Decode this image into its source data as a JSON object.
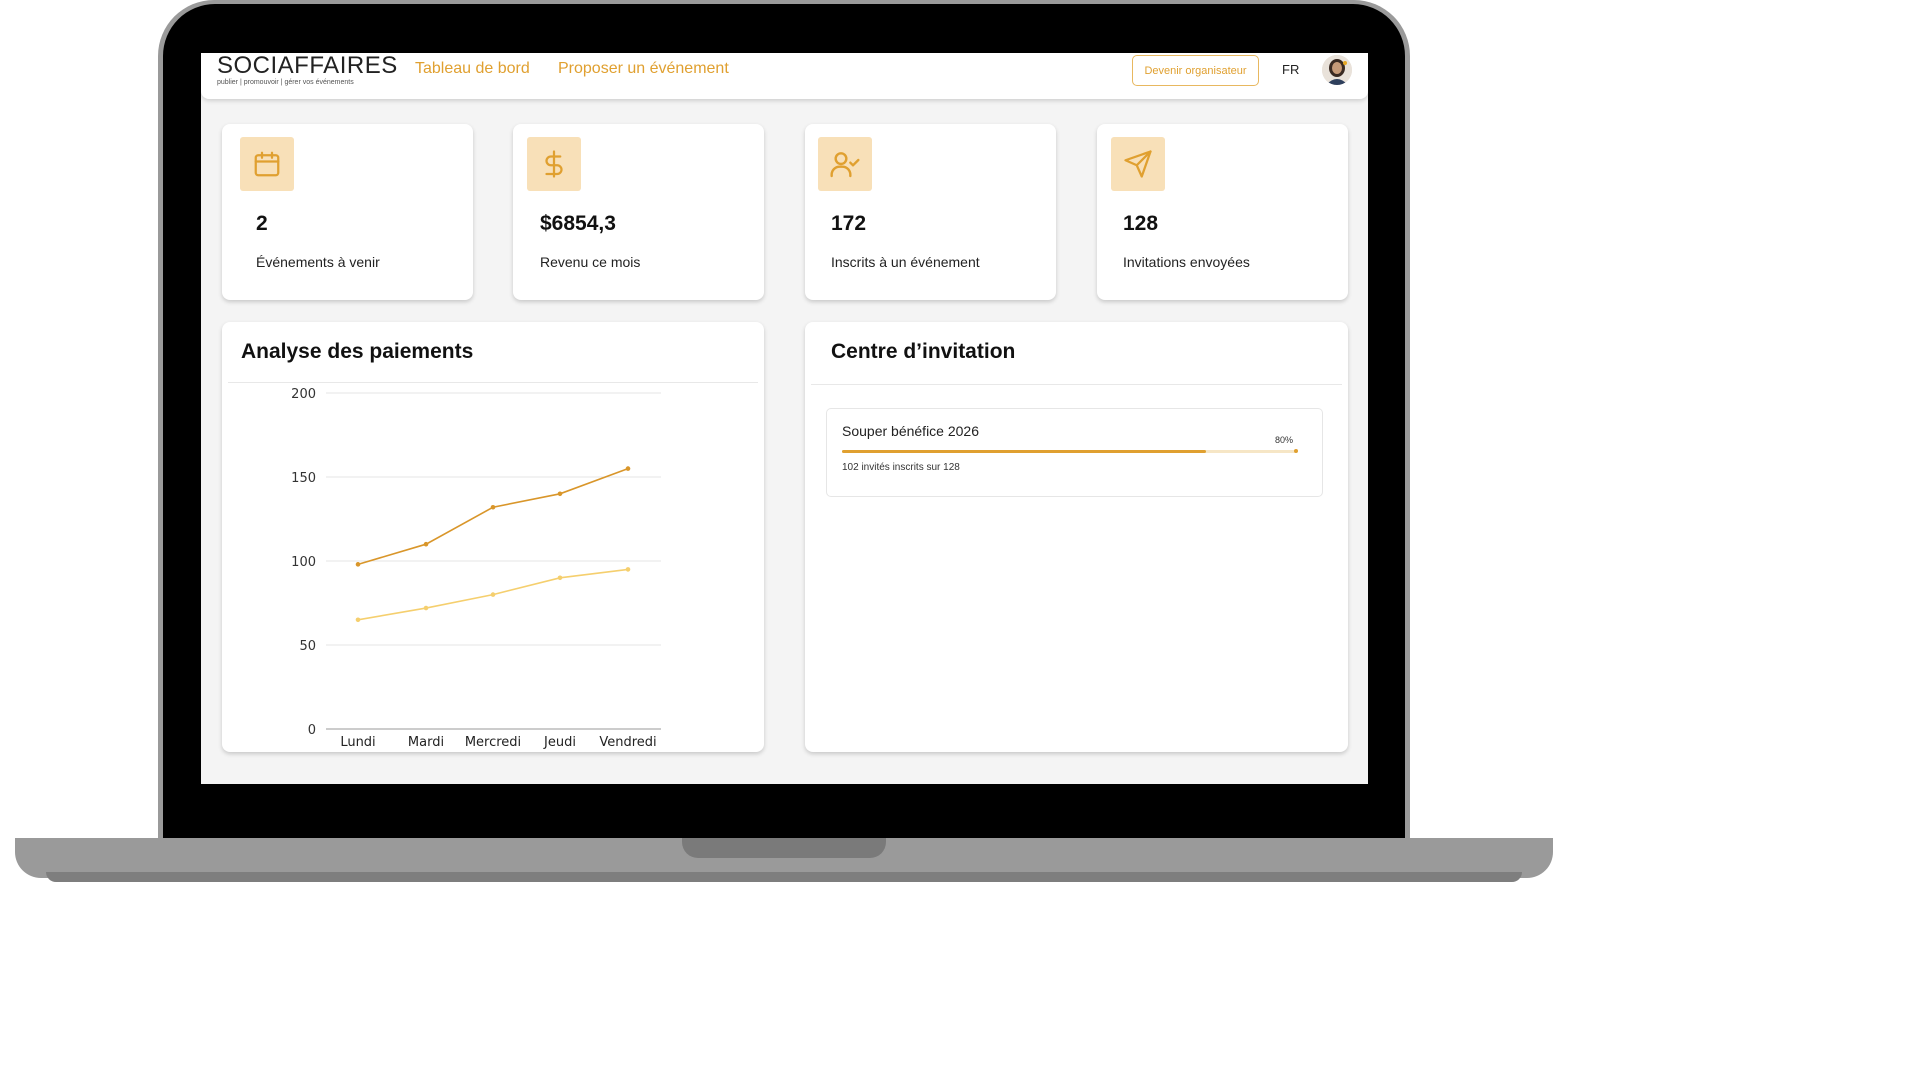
{
  "header": {
    "logo_name": "SOCIAFFAIRES",
    "logo_tagline": "publier | promouvoir | gérer vos événements",
    "nav": [
      "Tableau de bord",
      "Proposer un événement"
    ],
    "organizer_button": "Devenir organisateur",
    "language": "FR"
  },
  "stats": [
    {
      "value": "2",
      "label": "Événements à venir",
      "icon": "calendar-icon"
    },
    {
      "value": "$6854,3",
      "label": "Revenu ce mois",
      "icon": "dollar-icon"
    },
    {
      "value": "172",
      "label": "Inscrits à un événement",
      "icon": "user-check-icon"
    },
    {
      "value": "128",
      "label": "Invitations envoyées",
      "icon": "send-icon"
    }
  ],
  "payments": {
    "title": "Analyse des paiements"
  },
  "chart_data": {
    "type": "line",
    "categories": [
      "Lundi",
      "Mardi",
      "Mercredi",
      "Jeudi",
      "Vendredi"
    ],
    "series": [
      {
        "values": [
          98,
          110,
          132,
          140,
          155
        ],
        "color": "#d9962a"
      },
      {
        "values": [
          65,
          72,
          80,
          90,
          95
        ],
        "color": "#f5cf6e"
      }
    ],
    "yticks": [
      0,
      50,
      100,
      150,
      200
    ],
    "ylim": [
      0,
      200
    ],
    "grid": true,
    "title": "",
    "xlabel": "",
    "ylabel": ""
  },
  "invitations": {
    "title": "Centre d’invitation",
    "event_name": "Souper bénéfice 2026",
    "percent_label": "80%",
    "progress": 0.8,
    "summary": "102 invités inscrits sur 128"
  },
  "colors": {
    "accent": "#e0a030",
    "icon_bg": "#f8e0b8"
  }
}
